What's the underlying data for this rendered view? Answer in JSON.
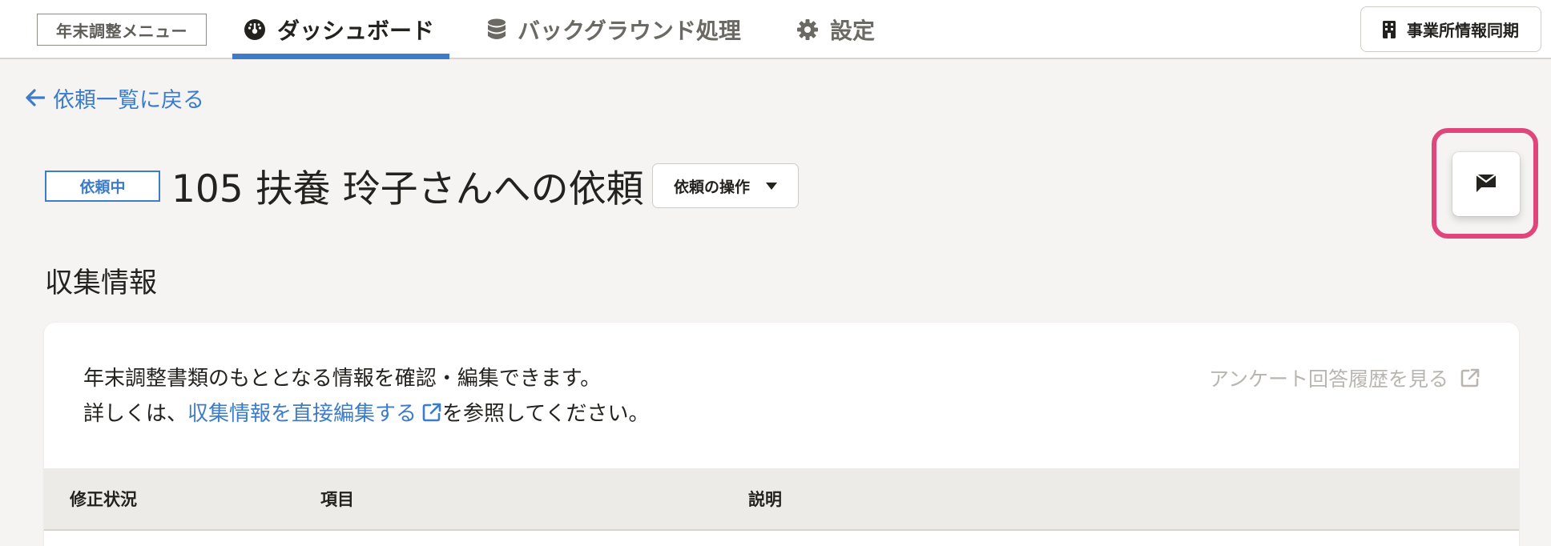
{
  "header": {
    "menu_badge": "年末調整メニュー",
    "tabs": [
      {
        "label": "ダッシュボード",
        "icon": "dashboard-gauge-icon",
        "active": true
      },
      {
        "label": "バックグラウンド処理",
        "icon": "database-icon",
        "active": false
      },
      {
        "label": "設定",
        "icon": "gear-icon",
        "active": false
      }
    ],
    "sync_button": {
      "label": "事業所情報同期",
      "icon": "building-icon"
    }
  },
  "back_link": {
    "label": "依頼一覧に戻る",
    "icon": "arrow-left-icon"
  },
  "request": {
    "status": "依頼中",
    "title": "105 扶養 玲子さんへの依頼",
    "ops_button": "依頼の操作",
    "message_button_icon": "message-envelope-icon"
  },
  "section": {
    "title": "収集情報",
    "description_line1": "年末調整書類のもととなる情報を確認・編集できます。",
    "description_line2_prefix": "詳しくは、",
    "description_link": "収集情報を直接編集する",
    "description_line2_suffix": "を参照してください。",
    "history_link": "アンケート回答履歴を見る"
  },
  "table": {
    "columns": [
      "修正状況",
      "項目",
      "説明"
    ]
  },
  "colors": {
    "accent": "#3d7cc9",
    "highlight": "#e0467c",
    "background": "#f5f4f2"
  }
}
